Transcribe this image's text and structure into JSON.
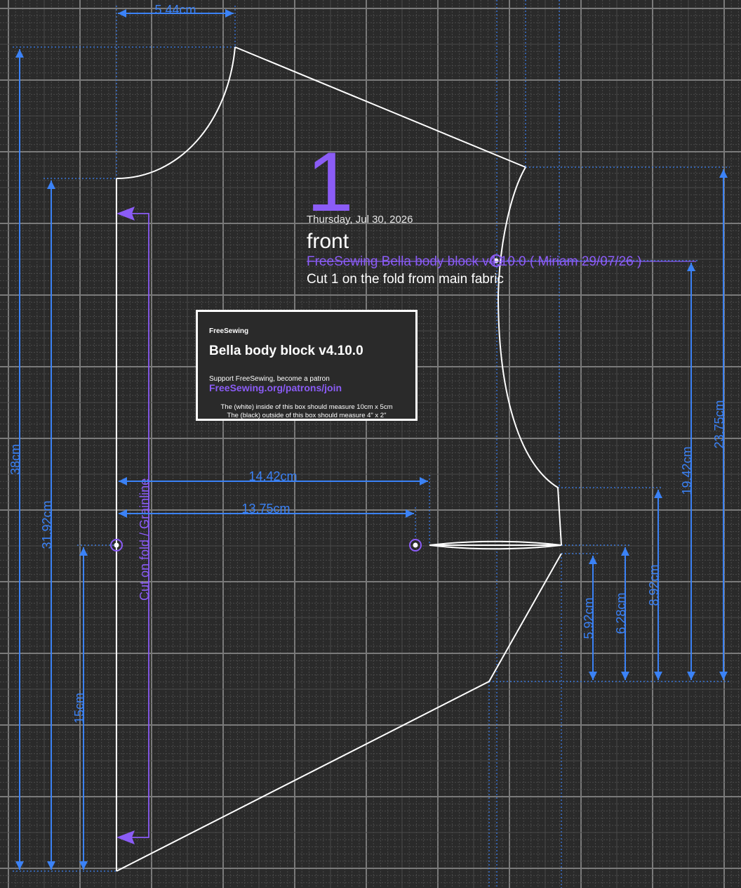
{
  "colors": {
    "background": "#2a2a2a",
    "grid_minor": "#4a4a4a",
    "grid_major": "#7a7a7a",
    "outline": "#ffffff",
    "dimension": "#3b82f6",
    "accent": "#8b5cf6"
  },
  "piece": {
    "number": "1",
    "date": "Thursday, Jul 30, 2026",
    "name": "front",
    "design": "FreeSewing Bella body block v4.10.0 ( Miriam 29/07/26 )",
    "cut_instructions": "Cut 1 on the fold from main fabric",
    "grainline": "Cut on fold / Grainline"
  },
  "scalebox": {
    "brand": "FreeSewing",
    "title": "Bella body block v4.10.0",
    "support": "Support FreeSewing, become a patron",
    "link": "FreeSewing.org/patrons/join",
    "note_inside": "The (white) inside of this box should measure 10cm x 5cm",
    "note_outside": "The (black) outside of this box should measure 4\" x 2\""
  },
  "dimensions": {
    "neck_width": "5.44cm",
    "total_length": "38cm",
    "cf_length": "31.92cm",
    "waist_to_bottom": "15cm",
    "bust_width": "14.42cm",
    "bust_point_width": "13.75cm",
    "armhole_height": "23.75cm",
    "armhole_mid": "19.42cm",
    "side_upper": "8.92cm",
    "side_dart_upper": "6.28cm",
    "side_dart_lower": "5.92cm"
  }
}
